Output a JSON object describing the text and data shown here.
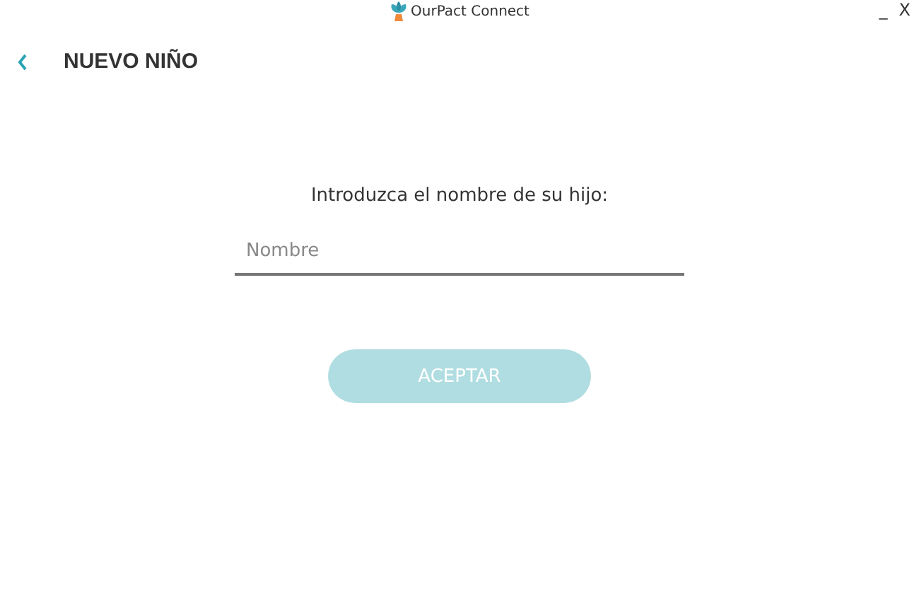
{
  "window": {
    "title": "OurPact Connect",
    "controls": [
      "_",
      "X"
    ]
  },
  "header": {
    "title": "NUEVO NIÑO"
  },
  "form": {
    "prompt": "Introduzca el nombre de su hijo:",
    "name_field": {
      "placeholder": "Nombre"
    },
    "submit": {
      "label": "ACEPTAR",
      "disabled": true
    }
  }
}
